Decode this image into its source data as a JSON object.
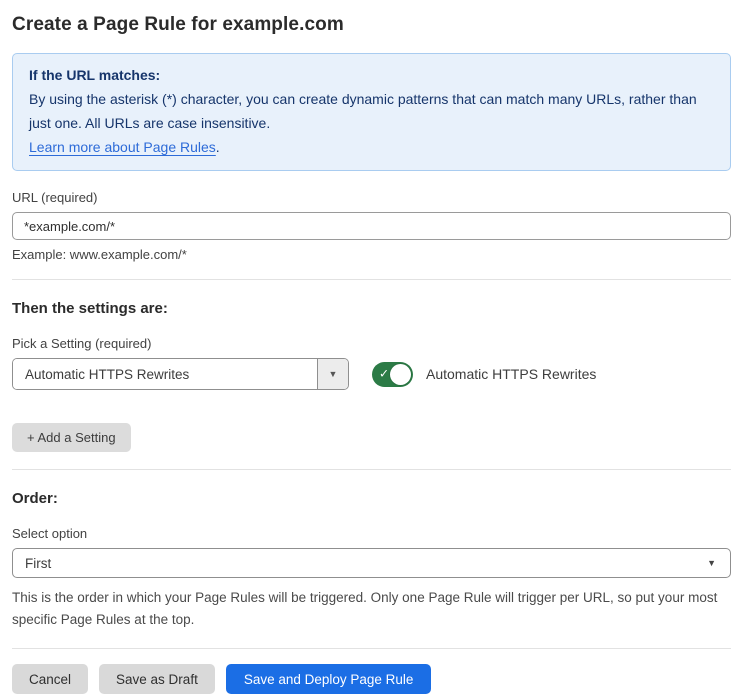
{
  "page": {
    "title": "Create a Page Rule for example.com"
  },
  "info_box": {
    "heading": "If the URL matches:",
    "body": "By using the asterisk (*) character, you can create dynamic patterns that can match many URLs, rather than just one. All URLs are case insensitive.",
    "link_label": "Learn more about Page Rules",
    "link_suffix": "."
  },
  "url_field": {
    "label": "URL (required)",
    "value": "*example.com/*",
    "helper": "Example: www.example.com/*"
  },
  "settings": {
    "heading": "Then the settings are:",
    "pick_label": "Pick a Setting (required)",
    "selected_setting": "Automatic HTTPS Rewrites",
    "dropdown_arrow": "▼",
    "toggle_state": "on",
    "toggle_check": "✓",
    "toggle_label": "Automatic HTTPS Rewrites",
    "add_button_label": "+ Add a Setting"
  },
  "order": {
    "heading": "Order:",
    "select_label": "Select option",
    "selected_option": "First",
    "dropdown_arrow": "▼",
    "helper": "This is the order in which your Page Rules will be triggered. Only one Page Rule will trigger per URL, so put your most specific Page Rules at the top."
  },
  "footer": {
    "cancel_label": "Cancel",
    "save_draft_label": "Save as Draft",
    "save_deploy_label": "Save and Deploy Page Rule"
  },
  "colors": {
    "info_background": "#e8f1fb",
    "info_border": "#a9ccf0",
    "info_text": "#16356b",
    "link_blue": "#2d6bd8",
    "toggle_green": "#2c7b46",
    "primary_blue": "#1b6ee5",
    "gray_button": "#d9d9d9"
  }
}
